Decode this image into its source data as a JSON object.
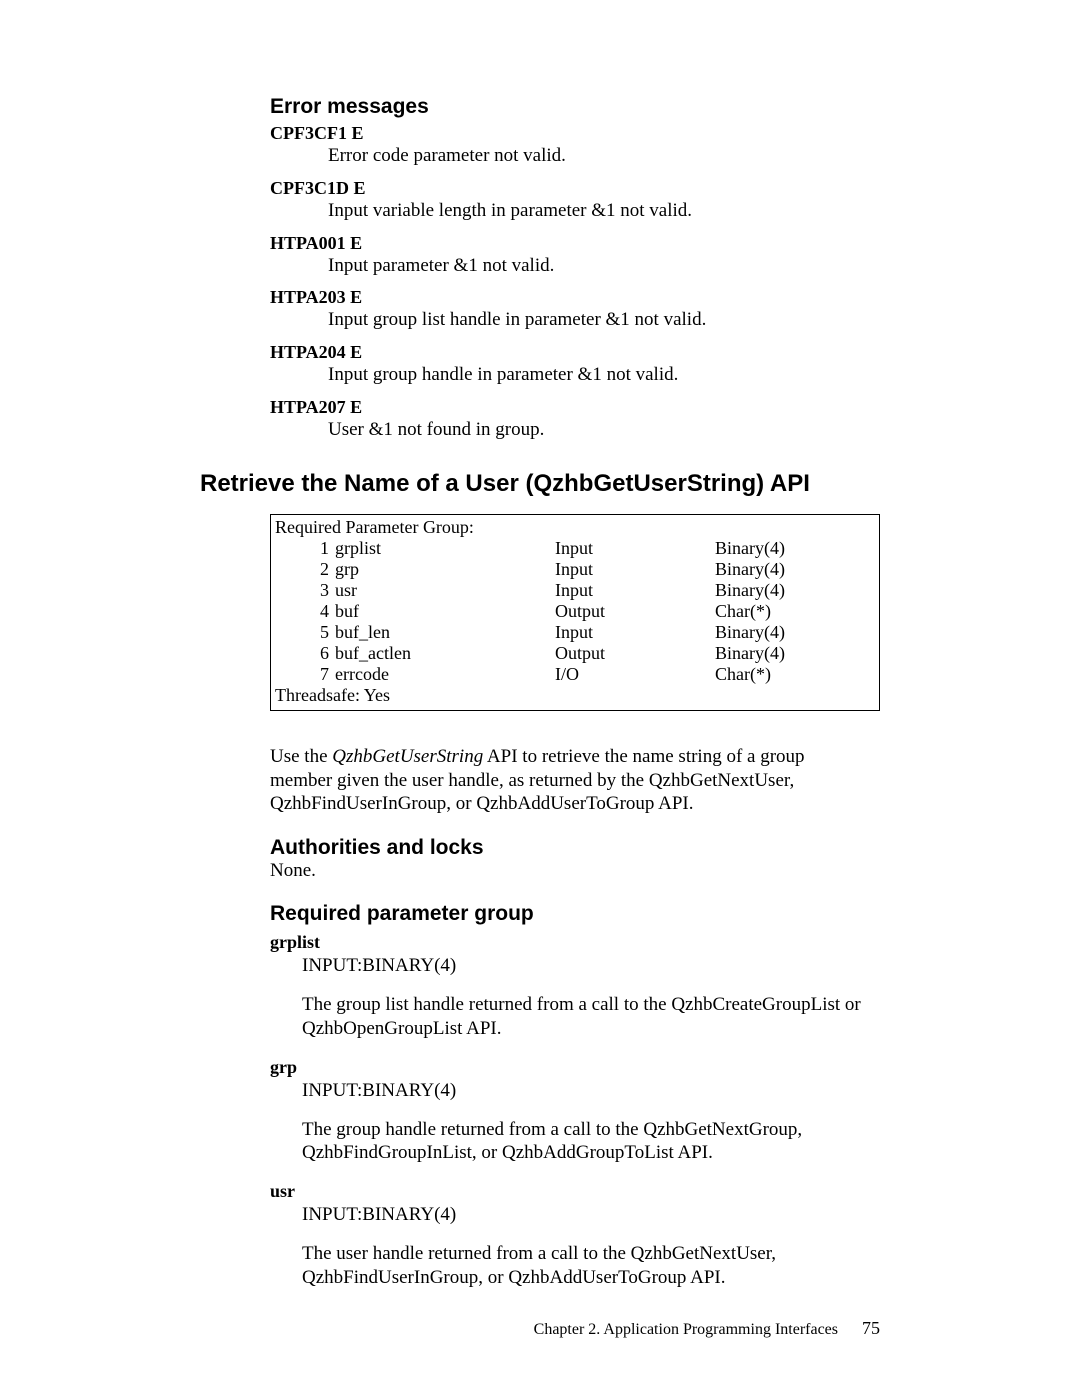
{
  "error_messages": {
    "heading": "Error messages",
    "items": [
      {
        "code": "CPF3CF1 E",
        "desc": "Error code parameter not valid."
      },
      {
        "code": "CPF3C1D E",
        "desc": "Input variable length in parameter &1 not valid."
      },
      {
        "code": "HTPA001 E",
        "desc": "Input parameter &1 not valid."
      },
      {
        "code": "HTPA203 E",
        "desc": "Input group list handle in parameter &1 not valid."
      },
      {
        "code": "HTPA204 E",
        "desc": "Input group handle in parameter &1 not valid."
      },
      {
        "code": "HTPA207 E",
        "desc": "User &1 not found in group."
      }
    ]
  },
  "api": {
    "title": "Retrieve the Name of a User (QzhbGetUserString) API",
    "box": {
      "heading": "Required Parameter Group:",
      "rows": [
        {
          "n": "1",
          "name": "grplist",
          "io": "Input",
          "type": "Binary(4)"
        },
        {
          "n": "2",
          "name": "grp",
          "io": "Input",
          "type": "Binary(4)"
        },
        {
          "n": "3",
          "name": "usr",
          "io": "Input",
          "type": "Binary(4)"
        },
        {
          "n": "4",
          "name": "buf",
          "io": "Output",
          "type": "Char(*)"
        },
        {
          "n": "5",
          "name": "buf_len",
          "io": "Input",
          "type": "Binary(4)"
        },
        {
          "n": "6",
          "name": "buf_actlen",
          "io": "Output",
          "type": "Binary(4)"
        },
        {
          "n": "7",
          "name": "errcode",
          "io": "I/O",
          "type": "Char(*)"
        }
      ],
      "threadsafe": "Threadsafe: Yes"
    },
    "desc_pre": "Use the ",
    "desc_ital": "QzhbGetUserString",
    "desc_post": " API to retrieve the name string of a group member given the user handle, as returned by the QzhbGetNextUser, QzhbFindUserInGroup, or QzhbAddUserToGroup API.",
    "auth_heading": "Authorities and locks",
    "auth_body": "None.",
    "rpg_heading": "Required parameter group",
    "params": [
      {
        "name": "grplist",
        "type": "INPUT:BINARY(4)",
        "desc": "The group list handle returned from a call to the QzhbCreateGroupList or QzhbOpenGroupList API."
      },
      {
        "name": "grp",
        "type": "INPUT:BINARY(4)",
        "desc": "The group handle returned from a call to the QzhbGetNextGroup, QzhbFindGroupInList, or QzhbAddGroupToList API."
      },
      {
        "name": "usr",
        "type": "INPUT:BINARY(4)",
        "desc": "The user handle returned from a call to the QzhbGetNextUser, QzhbFindUserInGroup, or QzhbAddUserToGroup API."
      }
    ]
  },
  "footer": {
    "chapter": "Chapter 2. Application Programming Interfaces",
    "page": "75"
  }
}
